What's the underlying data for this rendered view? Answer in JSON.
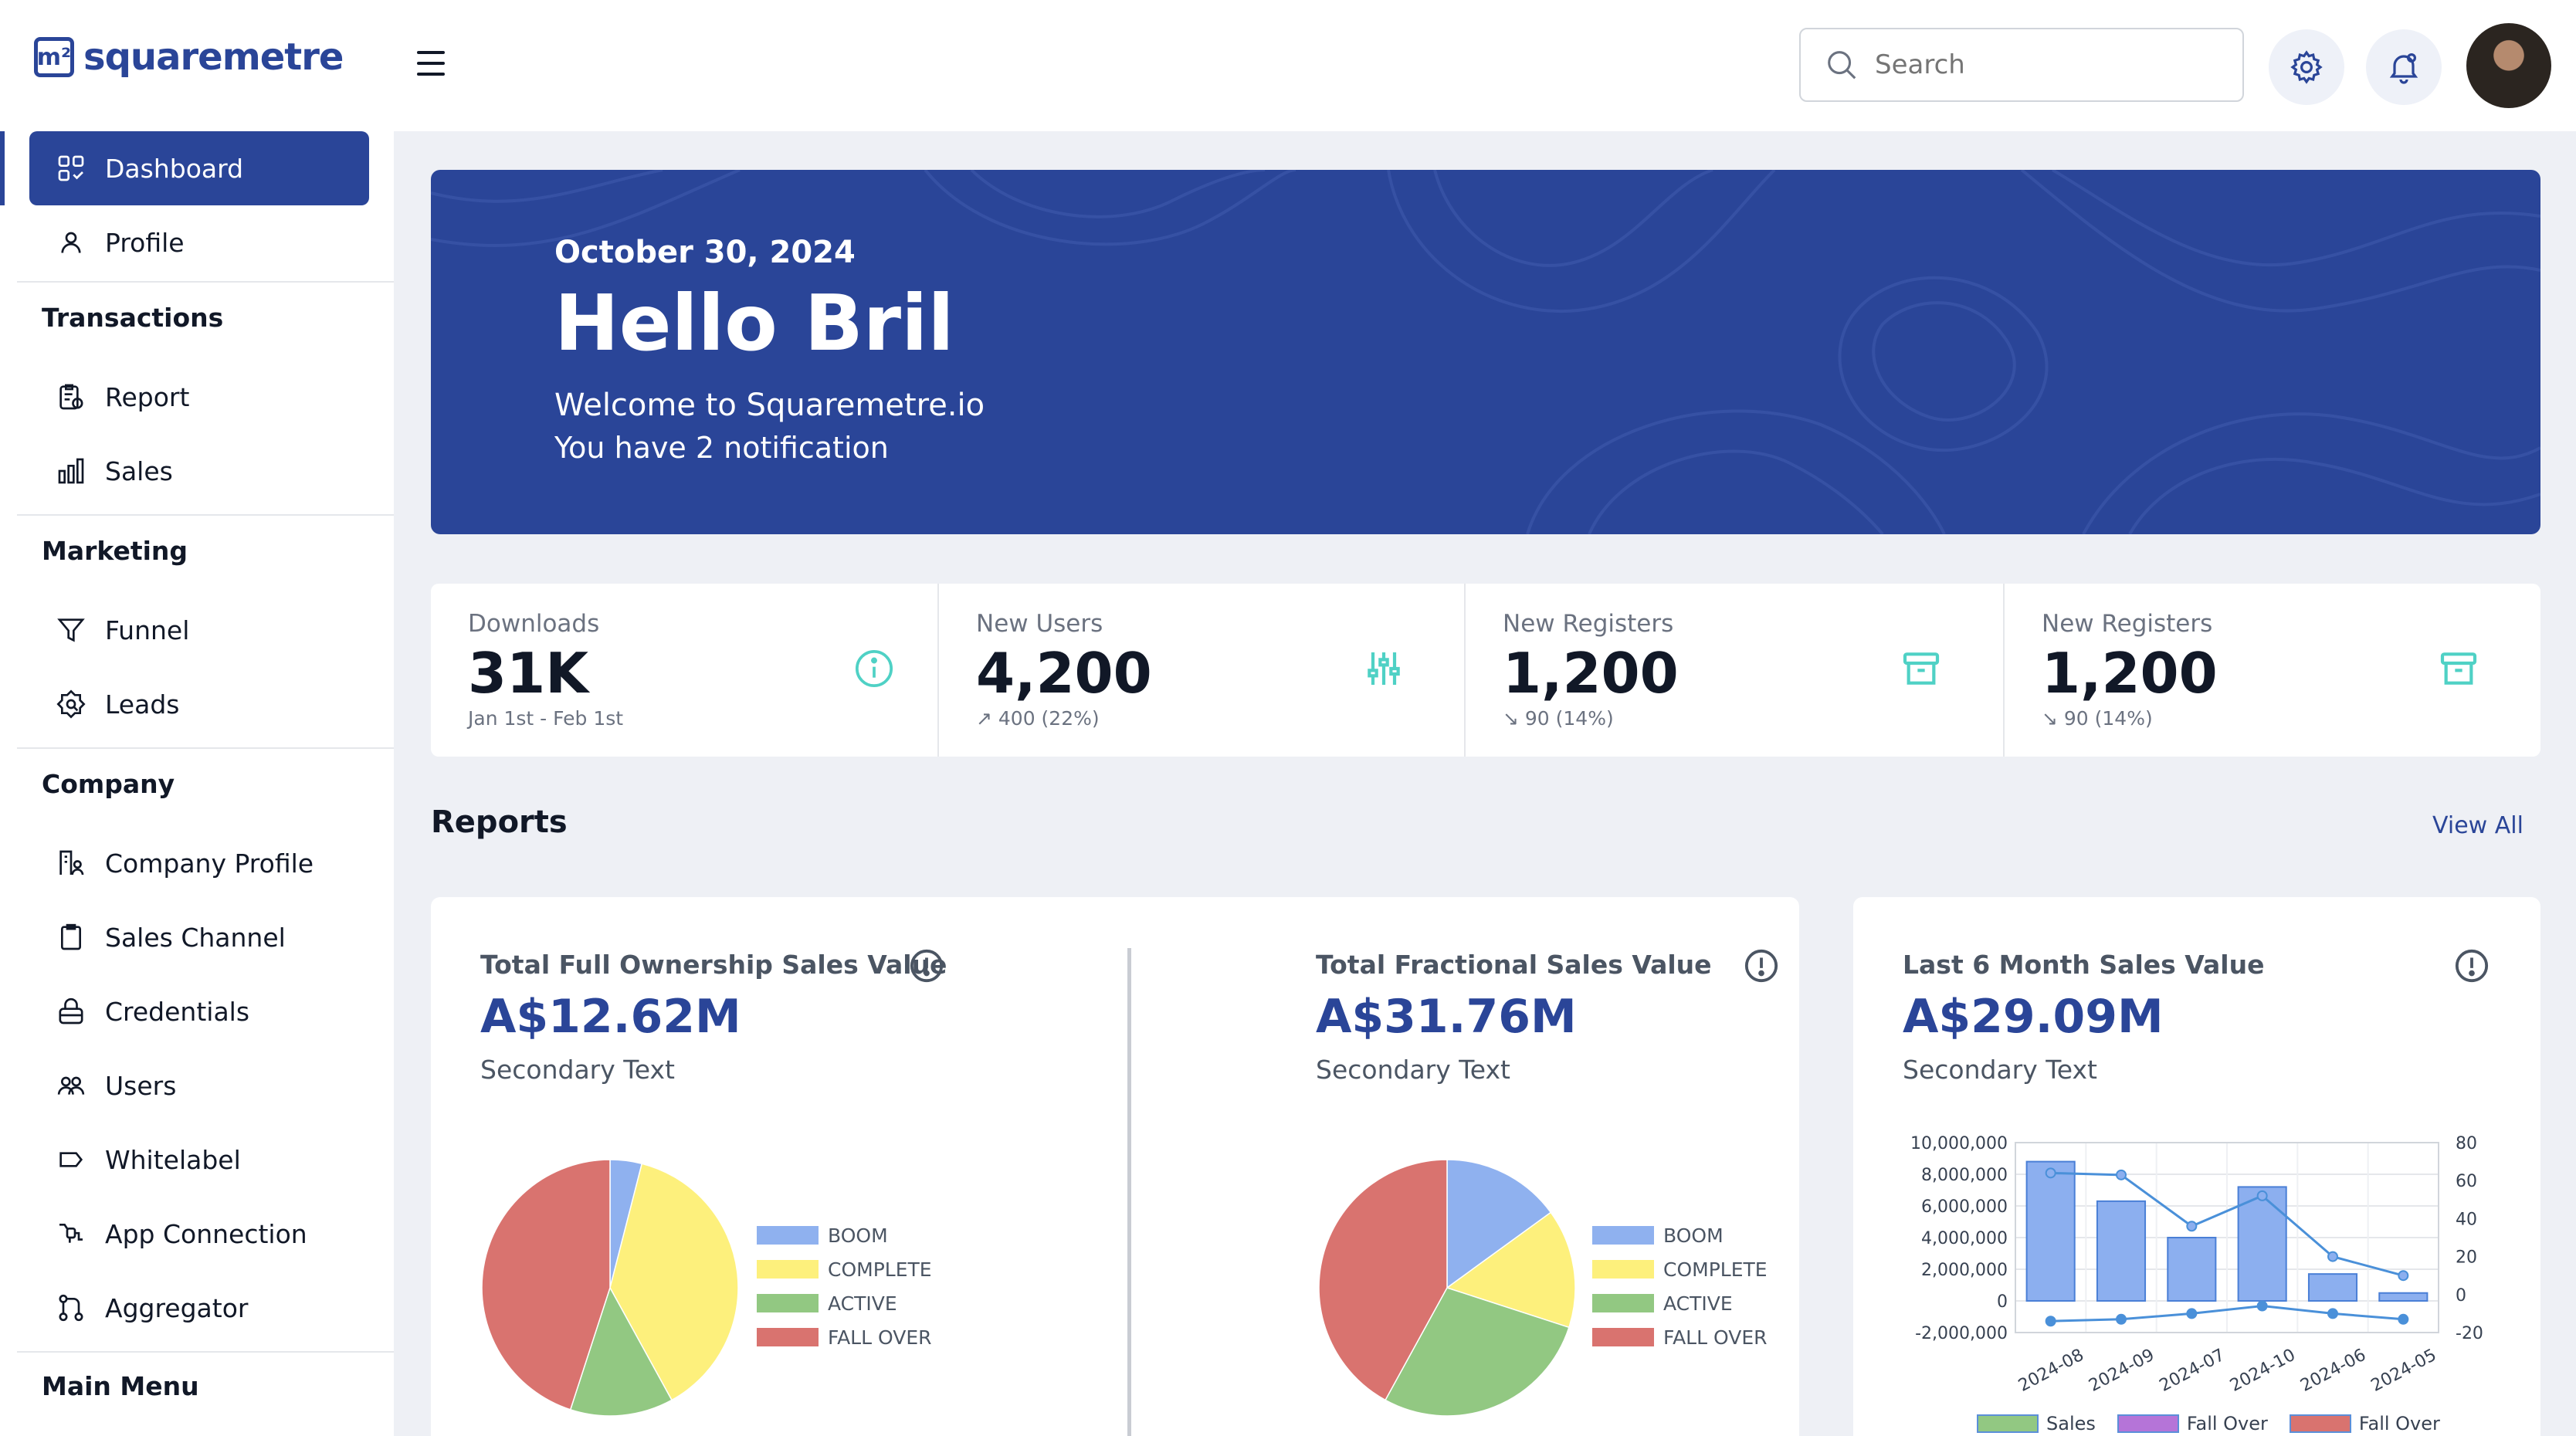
{
  "header": {
    "logo_mark": "m²",
    "brand": "squaremetre",
    "search_placeholder": "Search"
  },
  "sidebar": {
    "items": [
      {
        "label": "Dashboard",
        "icon": "dashboard-icon"
      },
      {
        "label": "Profile",
        "icon": "user-icon"
      }
    ],
    "sections": [
      {
        "title": "Transactions",
        "items": [
          {
            "label": "Report",
            "icon": "report-icon"
          },
          {
            "label": "Sales",
            "icon": "bar-chart-icon"
          }
        ]
      },
      {
        "title": "Marketing",
        "items": [
          {
            "label": "Funnel",
            "icon": "funnel-icon"
          },
          {
            "label": "Leads",
            "icon": "leads-icon"
          }
        ]
      },
      {
        "title": "Company",
        "items": [
          {
            "label": "Company Profile",
            "icon": "company-profile-icon"
          },
          {
            "label": "Sales Channel",
            "icon": "clipboard-icon"
          },
          {
            "label": "Credentials",
            "icon": "lock-icon"
          },
          {
            "label": "Users",
            "icon": "users-icon"
          },
          {
            "label": "Whitelabel",
            "icon": "tag-icon"
          },
          {
            "label": "App Connection",
            "icon": "plug-icon"
          },
          {
            "label": "Aggregator",
            "icon": "aggregator-icon"
          }
        ]
      },
      {
        "title": "Main Menu",
        "items": []
      }
    ]
  },
  "hero": {
    "date": "October 30, 2024",
    "greeting": "Hello Bril",
    "welcome": "Welcome to Squaremetre.io",
    "notifications": "You have 2 notification"
  },
  "stats": [
    {
      "label": "Downloads",
      "value": "31K",
      "sub": "Jan 1st - Feb 1st",
      "icon": "info-icon"
    },
    {
      "label": "New Users",
      "value": "4,200",
      "sub": "↗ 400 (22%)",
      "icon": "sliders-icon"
    },
    {
      "label": "New Registers",
      "value": "1,200",
      "sub": "↘ 90 (14%)",
      "icon": "archive-icon"
    },
    {
      "label": "New Registers",
      "value": "1,200",
      "sub": "↘ 90 (14%)",
      "icon": "archive-icon"
    }
  ],
  "reports": {
    "title": "Reports",
    "view_all": "View All"
  },
  "cards": [
    {
      "title": "Total Full Ownership Sales Value",
      "value": "A$12.62M",
      "secondary": "Secondary Text"
    },
    {
      "title": "Total Fractional Sales Value",
      "value": "A$31.76M",
      "secondary": "Secondary Text"
    },
    {
      "title": "Last 6 Month Sales Value",
      "value": "A$29.09M",
      "secondary": "Secondary Text"
    }
  ],
  "colors": {
    "primary": "#2a4598",
    "teal": "#4fd1c5",
    "boom": "#8fb1ef",
    "complete": "#fdf07c",
    "active": "#92c882",
    "fall_over": "#d9736f",
    "bar": "#8cafef",
    "line": "#4a90d9"
  },
  "chart_data": [
    {
      "type": "pie",
      "labels": [
        "BOOM",
        "COMPLETE",
        "ACTIVE",
        "FALL OVER"
      ],
      "values": [
        4,
        38,
        13,
        45
      ],
      "colors": [
        "#8fb1ef",
        "#fdf07c",
        "#92c882",
        "#d9736f"
      ]
    },
    {
      "type": "pie",
      "labels": [
        "BOOM",
        "COMPLETE",
        "ACTIVE",
        "FALL OVER"
      ],
      "values": [
        15,
        15,
        28,
        42
      ],
      "colors": [
        "#8fb1ef",
        "#fdf07c",
        "#92c882",
        "#d9736f"
      ]
    },
    {
      "type": "bar",
      "categories": [
        "2024-08",
        "2024-09",
        "2024-07",
        "2024-10",
        "2024-06",
        "2024-05"
      ],
      "series": [
        {
          "name": "Sales",
          "type": "bar",
          "axis": "left",
          "values": [
            8800000,
            6300000,
            4000000,
            7200000,
            1700000,
            500000
          ]
        },
        {
          "name": "Fall Over",
          "type": "line",
          "axis": "right",
          "values": [
            64,
            63,
            36,
            52,
            20,
            10
          ]
        },
        {
          "name": "Fall Over",
          "type": "line",
          "axis": "right",
          "values": [
            -14,
            -13,
            -10,
            -6,
            -10,
            -13
          ]
        }
      ],
      "ylim_left": [
        -2000000,
        10000000
      ],
      "yticks_left": [
        "10,000,000",
        "8,000,000",
        "6,000,000",
        "4,000,000",
        "2,000,000",
        "0",
        "-2,000,000"
      ],
      "ylim_right": [
        -20,
        80
      ],
      "yticks_right": [
        "80",
        "60",
        "40",
        "20",
        "0",
        "-20"
      ],
      "grid": true,
      "legend": "bottom"
    }
  ]
}
